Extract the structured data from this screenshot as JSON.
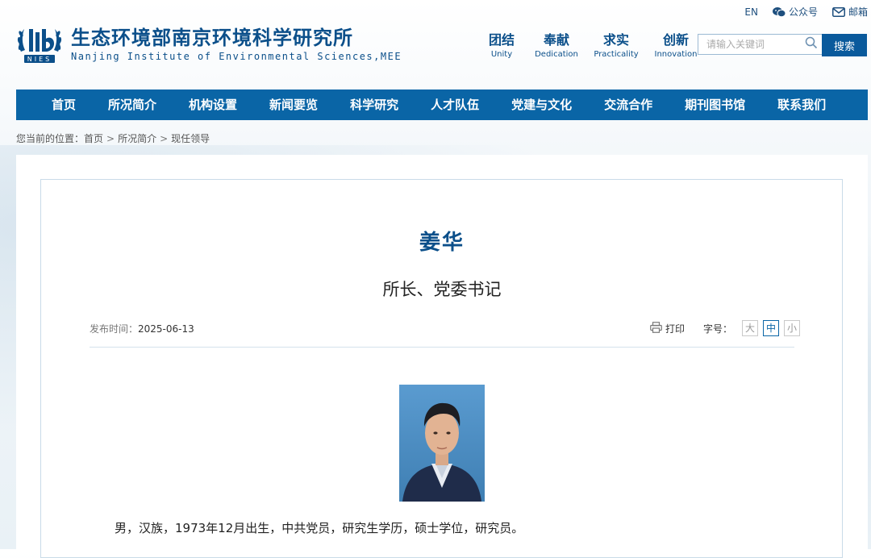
{
  "topbar": {
    "lang": "EN",
    "wechat": "公众号",
    "mail": "邮箱"
  },
  "logo": {
    "badge_text": "NIES",
    "cn": "生态环境部南京环境科学研究所",
    "en": "Nanjing Institute of Environmental Sciences,MEE"
  },
  "values": [
    {
      "cn": "团结",
      "en": "Unity"
    },
    {
      "cn": "奉献",
      "en": "Dedication"
    },
    {
      "cn": "求实",
      "en": "Practicality"
    },
    {
      "cn": "创新",
      "en": "Innovation"
    }
  ],
  "search": {
    "placeholder": "请输入关键词",
    "button": "搜索"
  },
  "nav": [
    "首页",
    "所况简介",
    "机构设置",
    "新闻要览",
    "科学研究",
    "人才队伍",
    "党建与文化",
    "交流合作",
    "期刊图书馆",
    "联系我们"
  ],
  "breadcrumb": {
    "prefix": "您当前的位置：",
    "items": [
      "首页",
      "所况简介",
      "现任领导"
    ],
    "separator": ">"
  },
  "article": {
    "name": "姜华",
    "position": "所长、党委书记",
    "publish_label": "发布时间：",
    "publish_date": "2025-06-13",
    "print_label": "打印",
    "fontsize_label": "字号：",
    "fontsize_options": [
      "大",
      "中",
      "小"
    ],
    "fontsize_selected": "中",
    "bio": "男，汉族，1973年12月出生，中共党员，研究生学历，硕士学位，研究员。"
  },
  "colors": {
    "brand": "#0b4f8a",
    "nav_bg": "#0a65a6",
    "search_btn": "#0a5a9c"
  }
}
